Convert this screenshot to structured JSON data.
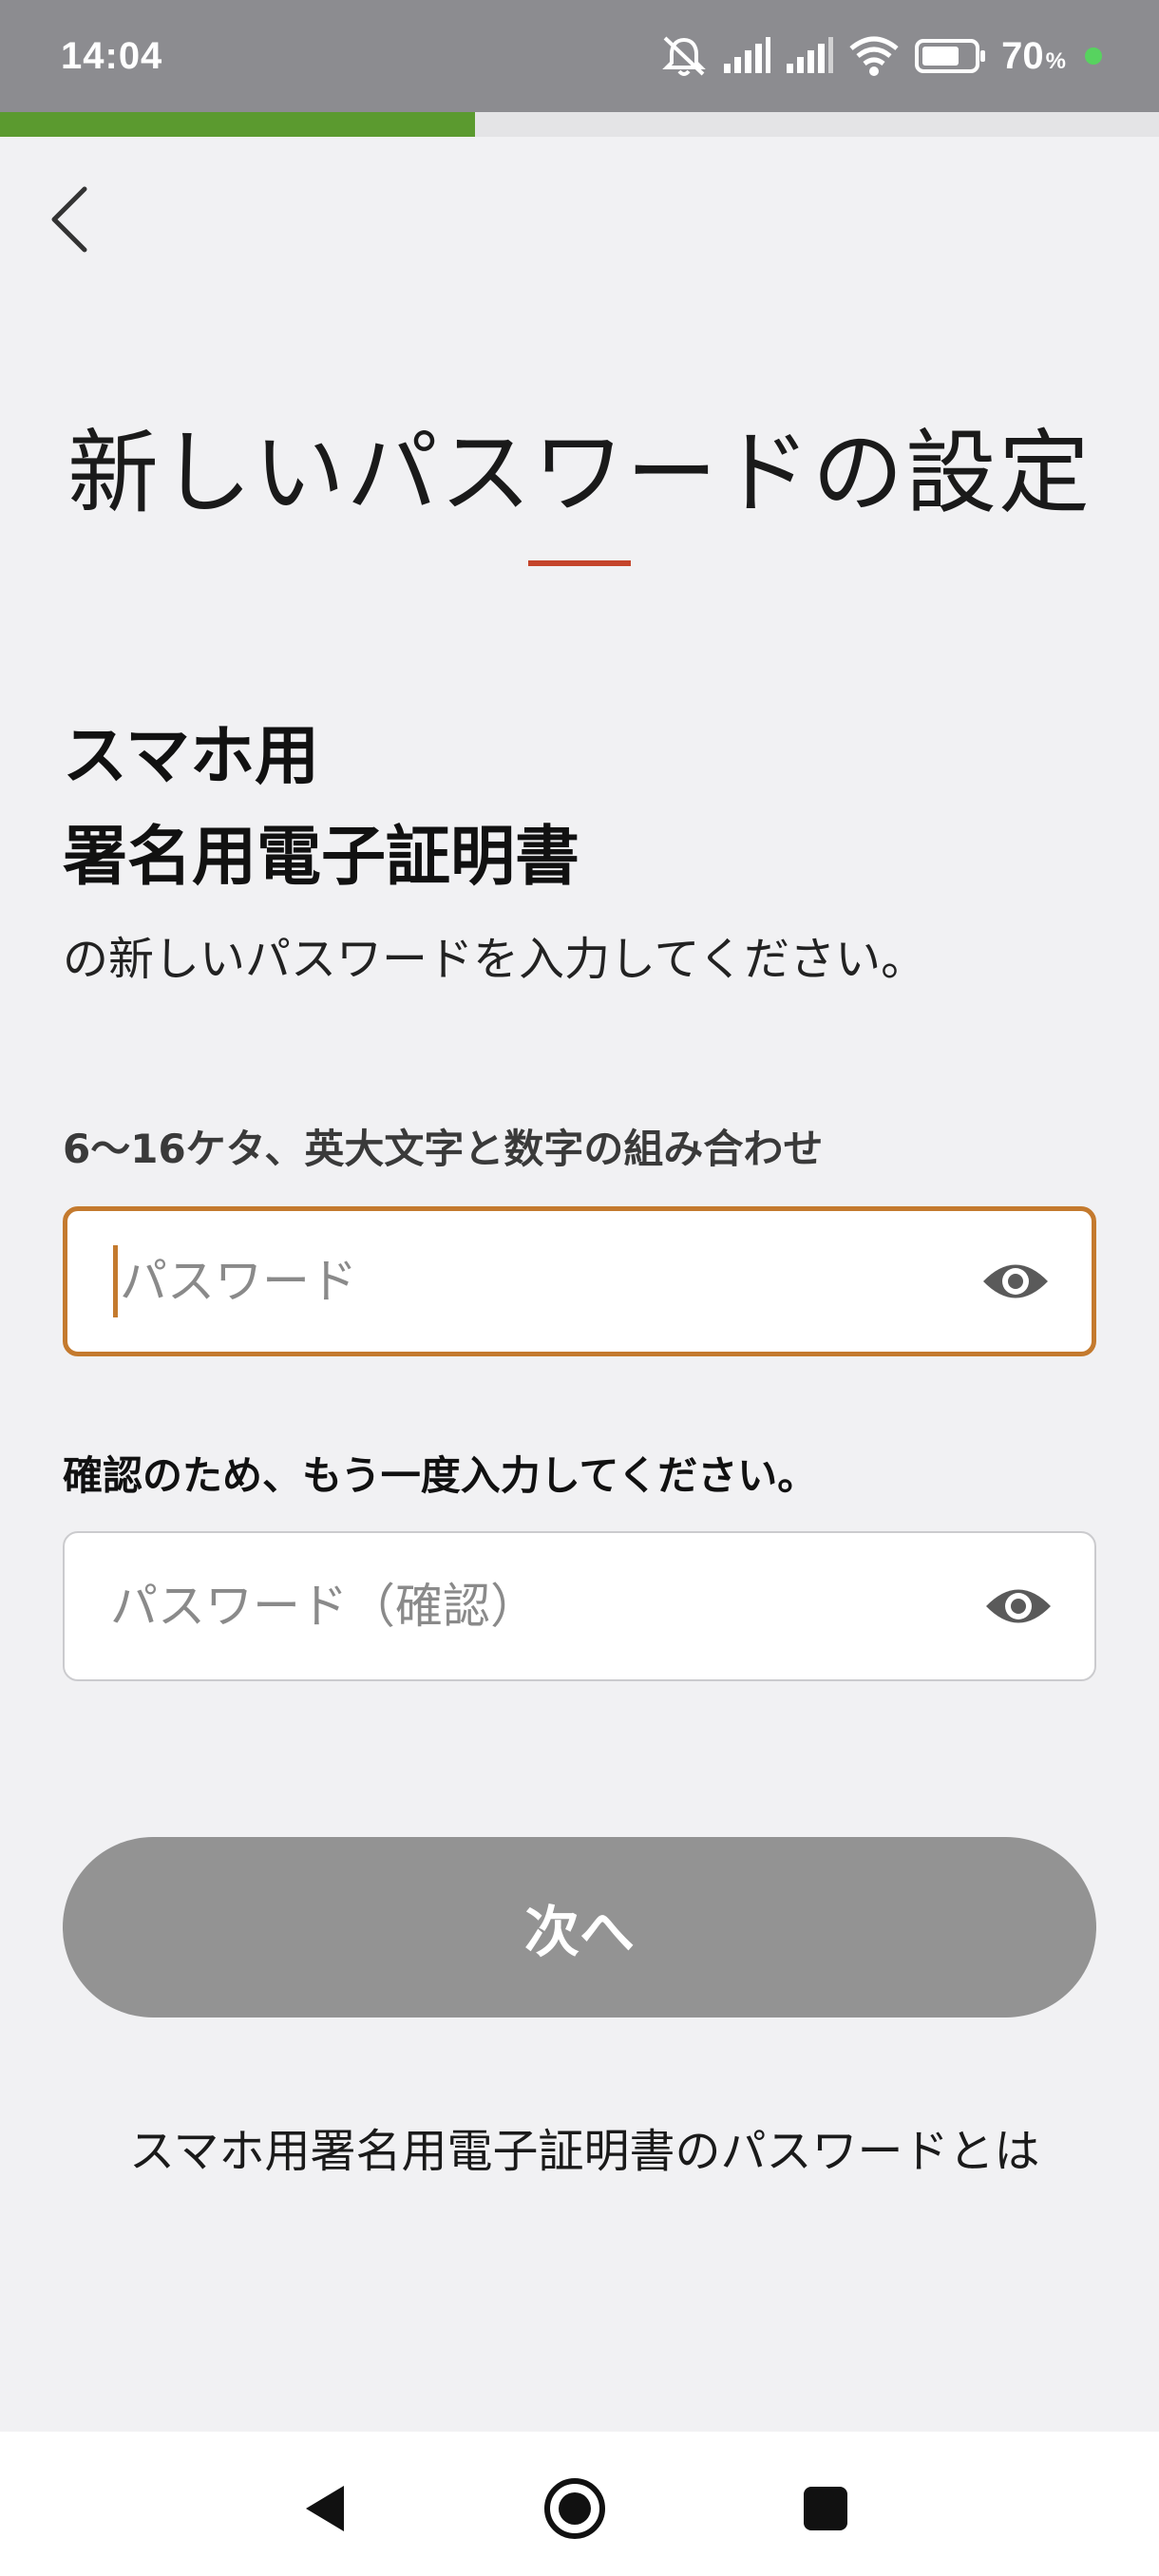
{
  "status_bar": {
    "time": "14:04",
    "battery_level": "70",
    "battery_unit": "%",
    "icons": [
      "mute-bell-icon",
      "signal-icon",
      "signal-icon",
      "wifi-icon",
      "battery-icon"
    ]
  },
  "progress": {
    "fraction": 0.41,
    "color": "#5b9a2f"
  },
  "header": {
    "title": "新しいパスワードの設定",
    "accent_color": "#c4442b"
  },
  "content": {
    "heading_line1": "スマホ用",
    "heading_line2": "署名用電子証明書",
    "instruction": "の新しいパスワードを入力してください。"
  },
  "form": {
    "password_hint": "6〜16ケタ、英大文字と数字の組み合わせ",
    "password_placeholder": "パスワード",
    "confirm_label": "確認のため、もう一度入力してください。",
    "confirm_placeholder": "パスワード（確認）"
  },
  "actions": {
    "next_label": "次へ",
    "help_link": "スマホ用署名用電子証明書のパスワードとは"
  },
  "nav": [
    "back-triangle-icon",
    "home-circle-icon",
    "recents-square-icon"
  ]
}
